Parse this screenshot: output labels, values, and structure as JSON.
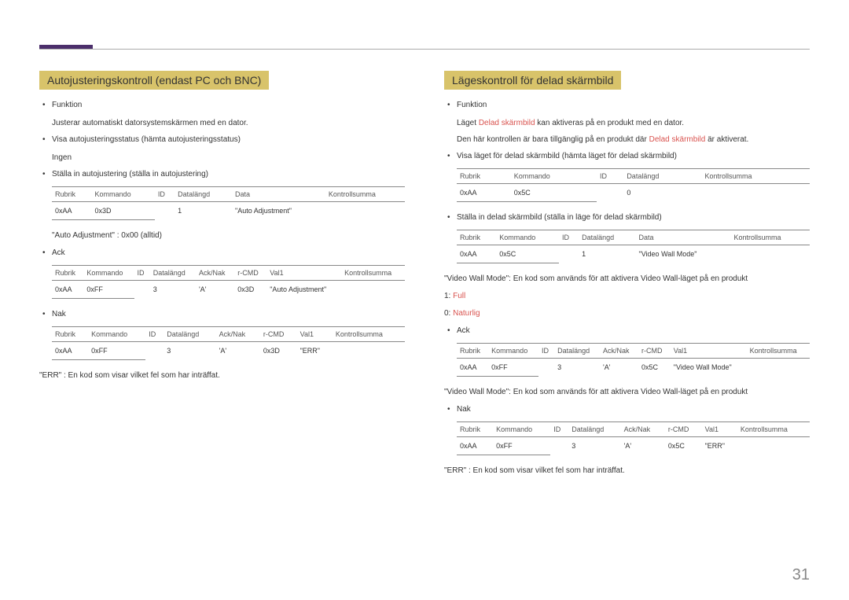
{
  "pageNumber": "31",
  "left": {
    "heading": "Autojusteringskontroll (endast PC och BNC)",
    "b1": "Funktion",
    "b1sub": "Justerar automatiskt datorsystemskärmen med en dator.",
    "b2": "Visa autojusteringsstatus (hämta autojusteringsstatus)",
    "b2sub": "Ingen",
    "b3": "Ställa in autojustering (ställa in autojustering)",
    "t1": {
      "h": [
        "Rubrik",
        "Kommando",
        "ID",
        "Datalängd",
        "Data",
        "Kontrollsumma"
      ],
      "r": [
        "0xAA",
        "0x3D",
        "",
        "1",
        "\"Auto Adjustment\"",
        ""
      ]
    },
    "note1": "\"Auto Adjustment\" : 0x00 (alltid)",
    "ack": "Ack",
    "t2": {
      "h": [
        "Rubrik",
        "Kommando",
        "ID",
        "Datalängd",
        "Ack/Nak",
        "r-CMD",
        "Val1",
        "Kontrollsumma"
      ],
      "r": [
        "0xAA",
        "0xFF",
        "",
        "3",
        "'A'",
        "0x3D",
        "\"Auto Adjustment\"",
        ""
      ]
    },
    "nak": "Nak",
    "t3": {
      "h": [
        "Rubrik",
        "Kommando",
        "ID",
        "Datalängd",
        "Ack/Nak",
        "r-CMD",
        "Val1",
        "Kontrollsumma"
      ],
      "r": [
        "0xAA",
        "0xFF",
        "",
        "3",
        "'A'",
        "0x3D",
        "\"ERR\"",
        ""
      ]
    },
    "err": "\"ERR\" : En kod som visar vilket fel som har inträffat."
  },
  "right": {
    "heading": "Lägeskontroll för delad skärmbild",
    "b1": "Funktion",
    "b1sub_a": "Läget ",
    "b1sub_hl1": "Delad skärmbild",
    "b1sub_b": " kan aktiveras på en produkt med en dator.",
    "b1sub2_a": "Den här kontrollen är bara tillgänglig på en produkt där ",
    "b1sub2_hl": "Delad skärmbild",
    "b1sub2_b": " är aktiverat.",
    "b2": "Visa läget för delad skärmbild (hämta läget för delad skärmbild)",
    "t1": {
      "h": [
        "Rubrik",
        "Kommando",
        "ID",
        "Datalängd",
        "Kontrollsumma"
      ],
      "r": [
        "0xAA",
        "0x5C",
        "",
        "0",
        ""
      ]
    },
    "b3": "Ställa in delad skärmbild (ställa in läge för delad skärmbild)",
    "t2": {
      "h": [
        "Rubrik",
        "Kommando",
        "ID",
        "Datalängd",
        "Data",
        "Kontrollsumma"
      ],
      "r": [
        "0xAA",
        "0x5C",
        "",
        "1",
        "\"Video Wall Mode\"",
        ""
      ]
    },
    "note1": "\"Video Wall Mode\": En kod som används för att aktivera Video Wall-läget på en produkt",
    "opt1_a": "1: ",
    "opt1_hl": "Full",
    "opt0_a": "0: ",
    "opt0_hl": "Naturlig",
    "ack": "Ack",
    "t3": {
      "h": [
        "Rubrik",
        "Kommando",
        "ID",
        "Datalängd",
        "Ack/Nak",
        "r-CMD",
        "Val1",
        "Kontrollsumma"
      ],
      "r": [
        "0xAA",
        "0xFF",
        "",
        "3",
        "'A'",
        "0x5C",
        "\"Video Wall Mode\"",
        ""
      ]
    },
    "note2": "\"Video Wall Mode\": En kod som används för att aktivera Video Wall-läget på en produkt",
    "nak": "Nak",
    "t4": {
      "h": [
        "Rubrik",
        "Kommando",
        "ID",
        "Datalängd",
        "Ack/Nak",
        "r-CMD",
        "Val1",
        "Kontrollsumma"
      ],
      "r": [
        "0xAA",
        "0xFF",
        "",
        "3",
        "'A'",
        "0x5C",
        "\"ERR\"",
        ""
      ]
    },
    "err": "\"ERR\" : En kod som visar vilket fel som har inträffat."
  }
}
